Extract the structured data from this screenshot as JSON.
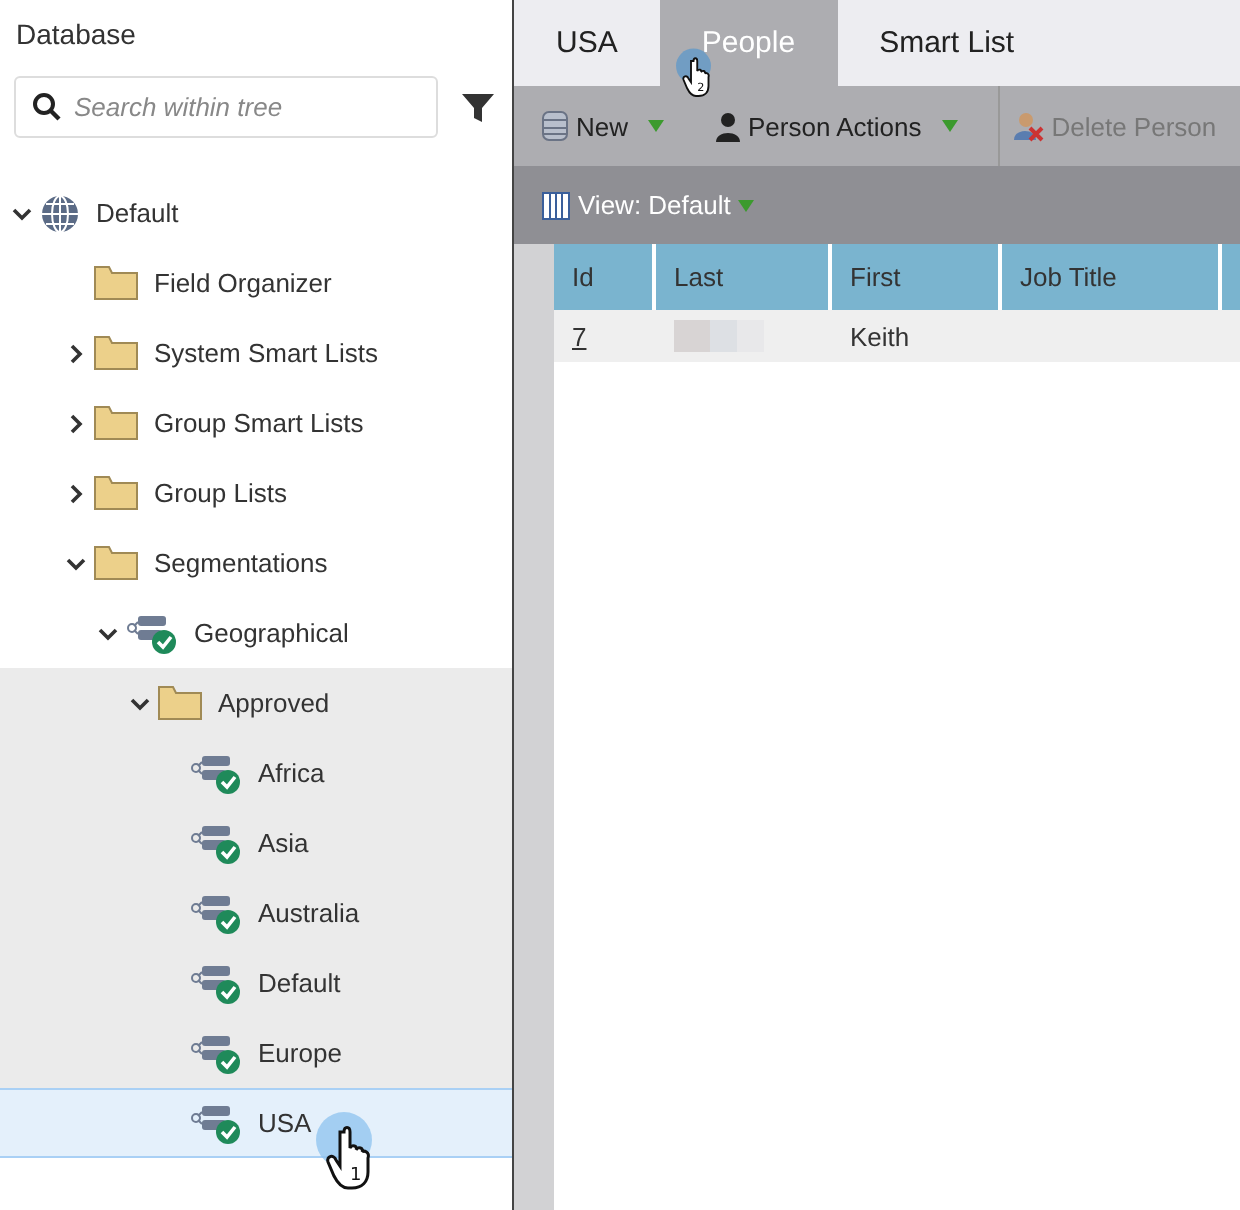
{
  "sidebar": {
    "title": "Database",
    "search": {
      "placeholder": "Search within tree"
    },
    "tree": [
      {
        "label": "Default",
        "kind": "globe",
        "expanded": true,
        "children": [
          {
            "label": "Field Organizer",
            "kind": "folder"
          },
          {
            "label": "System Smart Lists",
            "kind": "folder",
            "expanded": false
          },
          {
            "label": "Group Smart Lists",
            "kind": "folder",
            "expanded": false
          },
          {
            "label": "Group Lists",
            "kind": "folder",
            "expanded": false
          },
          {
            "label": "Segmentations",
            "kind": "folder",
            "expanded": true,
            "children": [
              {
                "label": "Geographical",
                "kind": "segmentation",
                "expanded": true,
                "children": [
                  {
                    "label": "Approved",
                    "kind": "folder",
                    "expanded": true,
                    "highlighted": true,
                    "children": [
                      {
                        "label": "Africa",
                        "kind": "segment",
                        "selected": false
                      },
                      {
                        "label": "Asia",
                        "kind": "segment",
                        "selected": false
                      },
                      {
                        "label": "Australia",
                        "kind": "segment",
                        "selected": false
                      },
                      {
                        "label": "Default",
                        "kind": "segment",
                        "selected": false
                      },
                      {
                        "label": "Europe",
                        "kind": "segment",
                        "selected": false
                      },
                      {
                        "label": "USA",
                        "kind": "segment",
                        "selected": true,
                        "step": "1"
                      }
                    ]
                  }
                ]
              }
            ]
          }
        ]
      }
    ]
  },
  "tabs": [
    {
      "label": "USA",
      "selected": false
    },
    {
      "label": "People",
      "selected": true,
      "step": "2"
    },
    {
      "label": "Smart List",
      "selected": false
    }
  ],
  "toolbar": [
    {
      "label": "New",
      "kind": "database",
      "disabled": false,
      "menu": true
    },
    {
      "label": "Person Actions",
      "kind": "person",
      "disabled": false,
      "menu": true
    },
    {
      "label": "Delete Person",
      "kind": "delete",
      "disabled": true,
      "menu": false
    }
  ],
  "view": {
    "label": "View: Default"
  },
  "table": {
    "columns": [
      "Id",
      "Last",
      "First",
      "Job Title"
    ],
    "rows": [
      {
        "id": "7",
        "last_redacted": true,
        "first": "Keith",
        "job_title": ""
      }
    ]
  }
}
